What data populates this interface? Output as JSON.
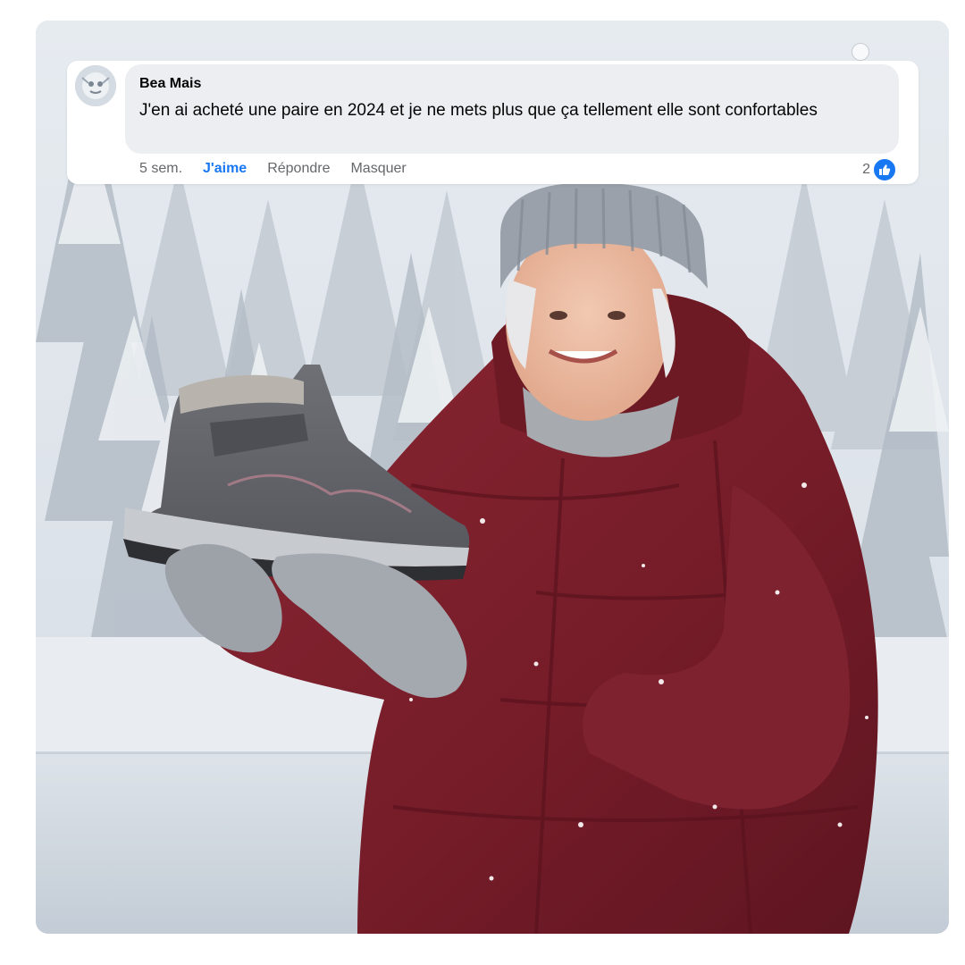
{
  "comment": {
    "author": "Bea Mais",
    "text": "J'en ai acheté une paire en 2024 et je ne mets plus que ça tellement elle sont confortables",
    "time": "5 sem.",
    "like_label": "J'aime",
    "reply_label": "Répondre",
    "hide_label": "Masquer",
    "reaction_count": "2"
  },
  "icons": {
    "avatar": "avatar",
    "reaction": "thumbs-up-icon"
  },
  "colors": {
    "accent": "#1877f2",
    "jacket": "#7a1f2b",
    "boot": "#5e6066"
  }
}
